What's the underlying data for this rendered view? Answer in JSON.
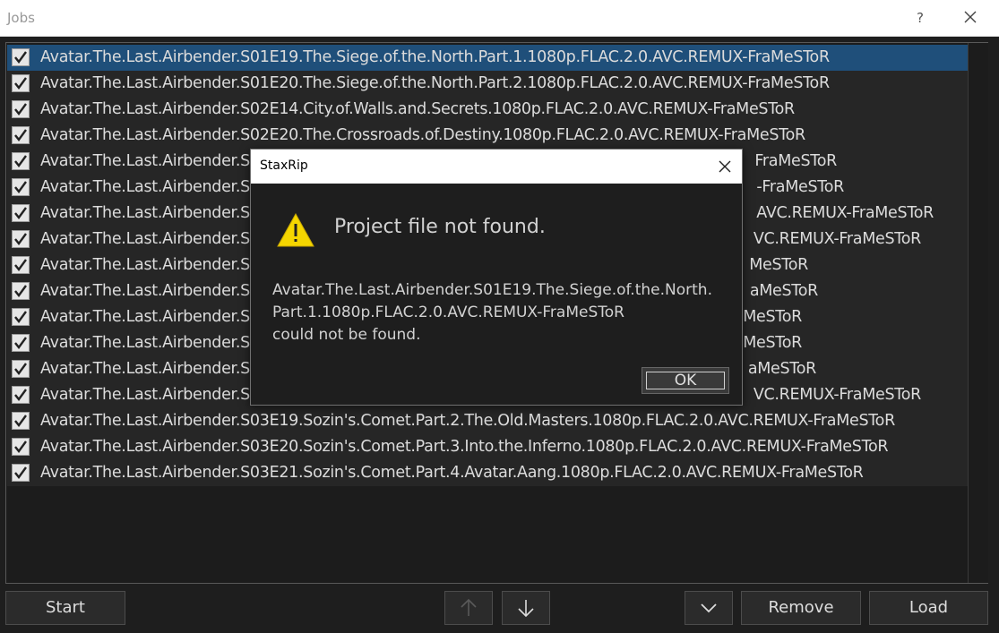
{
  "window": {
    "title": "Jobs",
    "help_label": "?",
    "close_icon": "close-icon"
  },
  "jobs": [
    "Avatar.The.Last.Airbender.S01E19.The.Siege.of.the.North.Part.1.1080p.FLAC.2.0.AVC.REMUX-FraMeSToR",
    "Avatar.The.Last.Airbender.S01E20.The.Siege.of.the.North.Part.2.1080p.FLAC.2.0.AVC.REMUX-FraMeSToR",
    "Avatar.The.Last.Airbender.S02E14.City.of.Walls.and.Secrets.1080p.FLAC.2.0.AVC.REMUX-FraMeSToR",
    "Avatar.The.Last.Airbender.S02E20.The.Crossroads.of.Destiny.1080p.FLAC.2.0.AVC.REMUX-FraMeSToR",
    "Avatar.The.Last.Airbender.S",
    "Avatar.The.Last.Airbender.S",
    "Avatar.The.Last.Airbender.S",
    "Avatar.The.Last.Airbender.S",
    "Avatar.The.Last.Airbender.S",
    "Avatar.The.Last.Airbender.S",
    "Avatar.The.Last.Airbender.S",
    "Avatar.The.Last.Airbender.S",
    "Avatar.The.Last.Airbender.S",
    "Avatar.The.Last.Airbender.S",
    "Avatar.The.Last.Airbender.S03E19.Sozin's.Comet.Part.2.The.Old.Masters.1080p.FLAC.2.0.AVC.REMUX-FraMeSToR",
    "Avatar.The.Last.Airbender.S03E20.Sozin's.Comet.Part.3.Into.the.Inferno.1080p.FLAC.2.0.AVC.REMUX-FraMeSToR",
    "Avatar.The.Last.Airbender.S03E21.Sozin's.Comet.Part.4.Avatar.Aang.1080p.FLAC.2.0.AVC.REMUX-FraMeSToR"
  ],
  "job_tails": [
    "",
    "",
    "",
    "",
    "FraMeSToR",
    "-FraMeSToR",
    "AVC.REMUX-FraMeSToR",
    "VC.REMUX-FraMeSToR",
    "MeSToR",
    "aMeSToR",
    "MeSToR",
    "MeSToR",
    "aMeSToR",
    "VC.REMUX-FraMeSToR",
    "",
    "",
    ""
  ],
  "buttons": {
    "start": "Start",
    "move_up_icon": "arrow-up-icon",
    "move_down_icon": "arrow-down-icon",
    "menu_icon": "chevron-down-icon",
    "remove": "Remove",
    "load": "Load"
  },
  "dialog": {
    "title": "StaxRip",
    "heading": "Project file not found.",
    "message_line1": "Avatar.The.Last.Airbender.S01E19.The.Siege.of.the.North.",
    "message_line2": "Part.1.1080p.FLAC.2.0.AVC.REMUX-FraMeSToR",
    "message_line3": "could not be found.",
    "ok": "OK",
    "icon": "warning-icon"
  },
  "colors": {
    "selected_row": "#1f4f7a",
    "background": "#1e1e1e",
    "warning": "#f5d600"
  }
}
